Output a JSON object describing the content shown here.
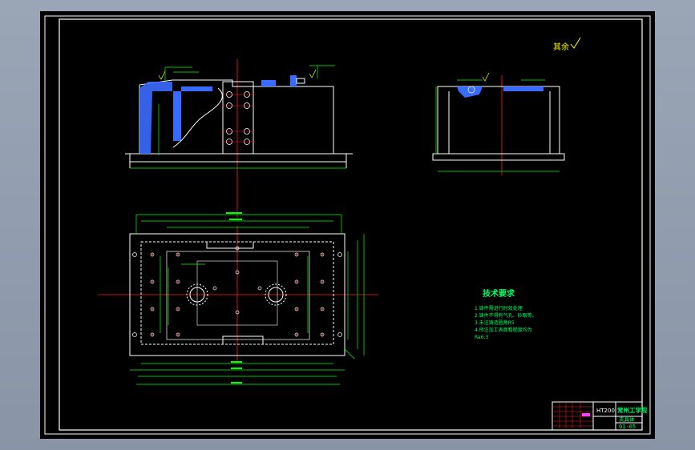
{
  "drawing": {
    "roughness_symbol": "其余",
    "title_block": {
      "material": "HT200",
      "institution": "常州工学院",
      "part_name": "夹具体",
      "drawing_number": "01-05"
    },
    "technical_requirements": {
      "heading": "技术要求",
      "lines": [
        "1.铸件需进行时效处理",
        "2.铸件不得有气孔、砂眼等。",
        "3.未注铸造圆角R5",
        "4.所注加工表面粗糙度均为",
        "Ra6.3"
      ]
    }
  },
  "colors": {
    "background": "#000000",
    "outline": "#ffffff",
    "centerline": "#ff2020",
    "dimension": "#00ff00",
    "hatch": "#3a6bff",
    "annotation": "#ffff00",
    "text": "#00ff66"
  }
}
